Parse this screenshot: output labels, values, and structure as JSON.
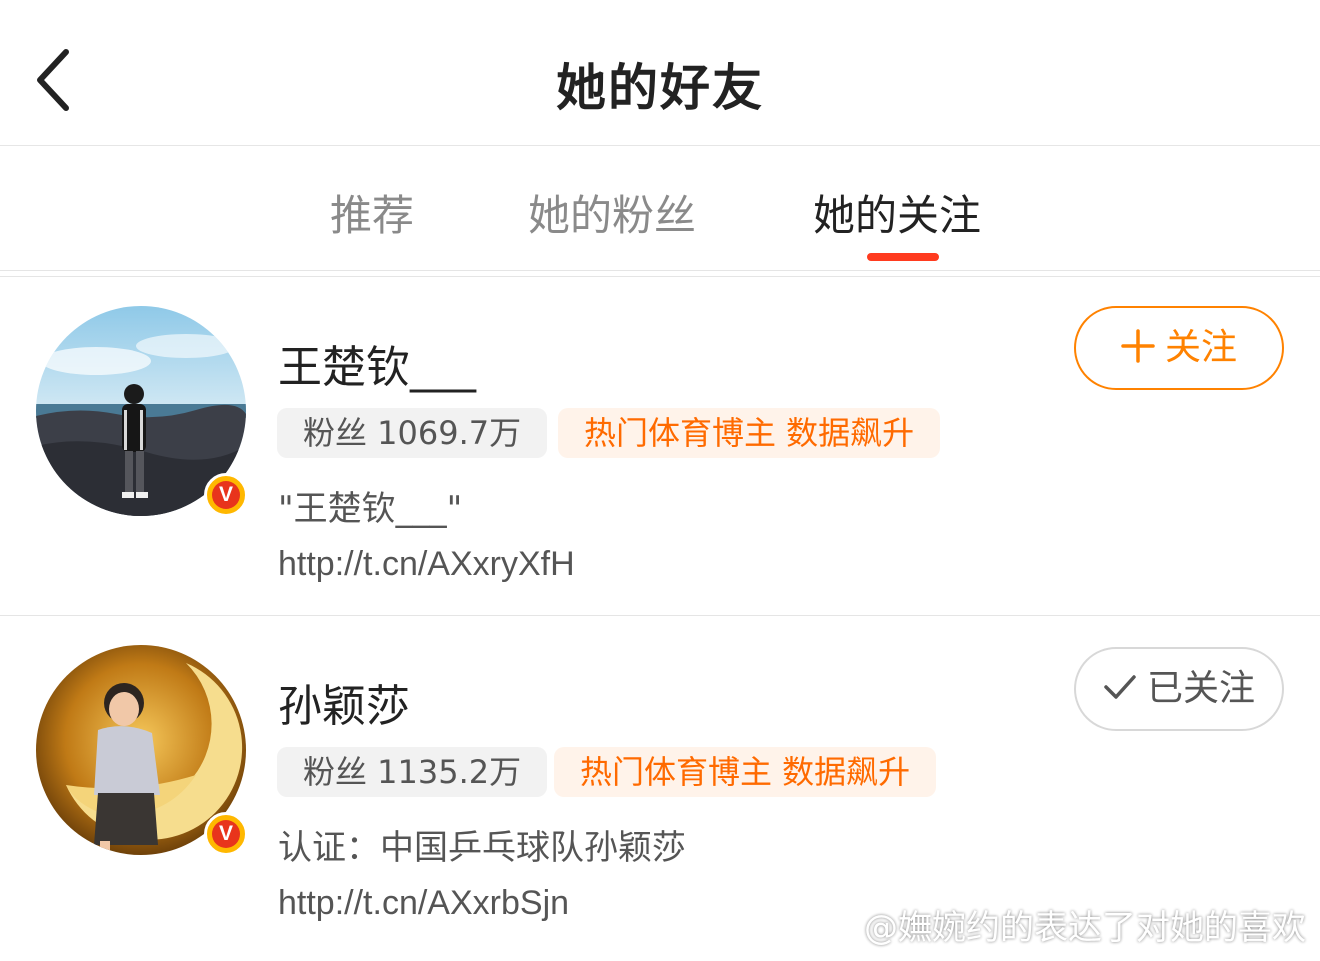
{
  "header": {
    "title": "她的好友"
  },
  "tabs": [
    {
      "label": "推荐",
      "active": false
    },
    {
      "label": "她的粉丝",
      "active": false
    },
    {
      "label": "她的关注",
      "active": true
    }
  ],
  "users": [
    {
      "name": "王楚钦___",
      "fans": "粉丝 1069.7万",
      "tag": "热门体育博主 数据飙升",
      "desc": "\"王楚钦___\"",
      "link": "http://t.cn/AXxryXfH",
      "button": "关注",
      "followed": false,
      "verified": true
    },
    {
      "name": "孙颖莎",
      "fans": "粉丝 1135.2万",
      "tag": "热门体育博主 数据飙升",
      "desc": "认证：中国乒乓球队孙颖莎",
      "link": "http://t.cn/AXxrbSjn",
      "button": "已关注",
      "followed": true,
      "verified": true
    }
  ],
  "watermark": "@嫵婉约的表达了对她的喜欢",
  "colors": {
    "accent": "#ff8200",
    "indicator": "#ff3b1f",
    "tag_text": "#ff6a00",
    "verified": "#ffb800"
  },
  "icons": {
    "back": "chevron-left-icon",
    "verified": "verified-v-icon",
    "plus": "plus-icon",
    "check": "check-icon"
  }
}
